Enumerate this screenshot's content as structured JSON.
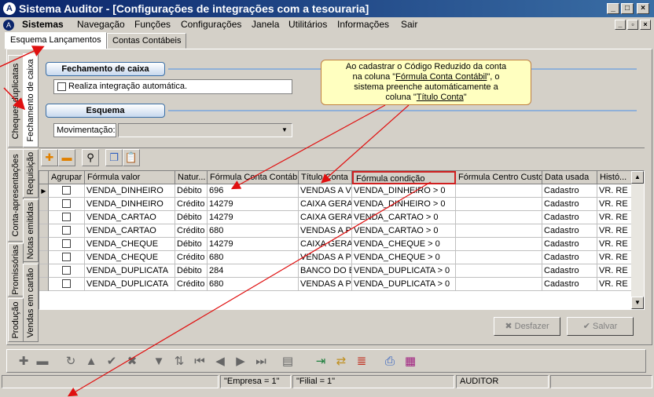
{
  "window": {
    "title": "Sistema Auditor - [Configurações de integrações com a tesouraria]"
  },
  "menu": [
    "Sistemas",
    "Navegação",
    "Funções",
    "Configurações",
    "Janela",
    "Utilitários",
    "Informações",
    "Sair"
  ],
  "tabs": [
    "Esquema Lançamentos",
    "Contas Contábeis"
  ],
  "vertical_tabs": [
    "Cheques duplicatas",
    "Fechamento de caixa",
    "Conta-apresentações",
    "Requisição",
    "Notas emitidas",
    "Promissórias",
    "Vendas em cartão",
    "Produção"
  ],
  "fechamento": {
    "header": "Fechamento de caixa",
    "checkbox_label": "Realiza integração automática."
  },
  "esquema": {
    "header": "Esquema",
    "movimentacao_label": "Movimentação:",
    "movimentacao_value": ""
  },
  "note": {
    "line1": "Ao cadastrar o Código Reduzido  da conta",
    "line2_pre": "na coluna \"",
    "line2_link": "Fórmula Conta Contábil",
    "line2_post": "\", o",
    "line3": "sistema preenche automáticamente a",
    "line4_pre": "coluna \"",
    "line4_link": "Título Conta",
    "line4_post": "\""
  },
  "grid": {
    "columns": [
      "Agrupar",
      "Fórmula valor",
      "Natur...",
      "Fórmula Conta Contábil",
      "Título Conta",
      "Fórmula condição",
      "Fórmula Centro Custo",
      "Data usada",
      "Histó..."
    ],
    "rows": [
      [
        "",
        "VENDA_DINHEIRO",
        "Débito",
        "696",
        "VENDAS A VI",
        "VENDA_DINHEIRO > 0",
        "",
        "Cadastro",
        "VR. RE"
      ],
      [
        "",
        "VENDA_DINHEIRO",
        "Crédito",
        "14279",
        "CAIXA GERAI",
        "VENDA_DINHEIRO > 0",
        "",
        "Cadastro",
        "VR. RE"
      ],
      [
        "",
        "VENDA_CARTAO",
        "Débito",
        "14279",
        "CAIXA GERAI",
        "VENDA_CARTAO > 0",
        "",
        "Cadastro",
        "VR. RE"
      ],
      [
        "",
        "VENDA_CARTAO",
        "Crédito",
        "680",
        "VENDAS A PI",
        "VENDA_CARTAO > 0",
        "",
        "Cadastro",
        "VR. RE"
      ],
      [
        "",
        "VENDA_CHEQUE",
        "Débito",
        "14279",
        "CAIXA GERAI",
        "VENDA_CHEQUE > 0",
        "",
        "Cadastro",
        "VR. RE"
      ],
      [
        "",
        "VENDA_CHEQUE",
        "Crédito",
        "680",
        "VENDAS A PI",
        "VENDA_CHEQUE > 0",
        "",
        "Cadastro",
        "VR. RE"
      ],
      [
        "",
        "VENDA_DUPLICATA",
        "Débito",
        "284",
        "BANCO DO B",
        "VENDA_DUPLICATA > 0",
        "",
        "Cadastro",
        "VR. RE"
      ],
      [
        "",
        "VENDA_DUPLICATA",
        "Crédito",
        "680",
        "VENDAS A PI",
        "VENDA_DUPLICATA > 0",
        "",
        "Cadastro",
        "VR. RE"
      ]
    ]
  },
  "buttons": {
    "desfazer": "Desfazer",
    "salvar": "Salvar"
  },
  "status": {
    "empresa": "\"Empresa = 1\"",
    "filial": "\"Filial = 1\"",
    "user": "AUDITOR"
  },
  "colors": {
    "title_bar": "#0a246a",
    "highlight_border": "#d02020",
    "note_bg": "#ffffc0",
    "arrow": "#e01010"
  }
}
